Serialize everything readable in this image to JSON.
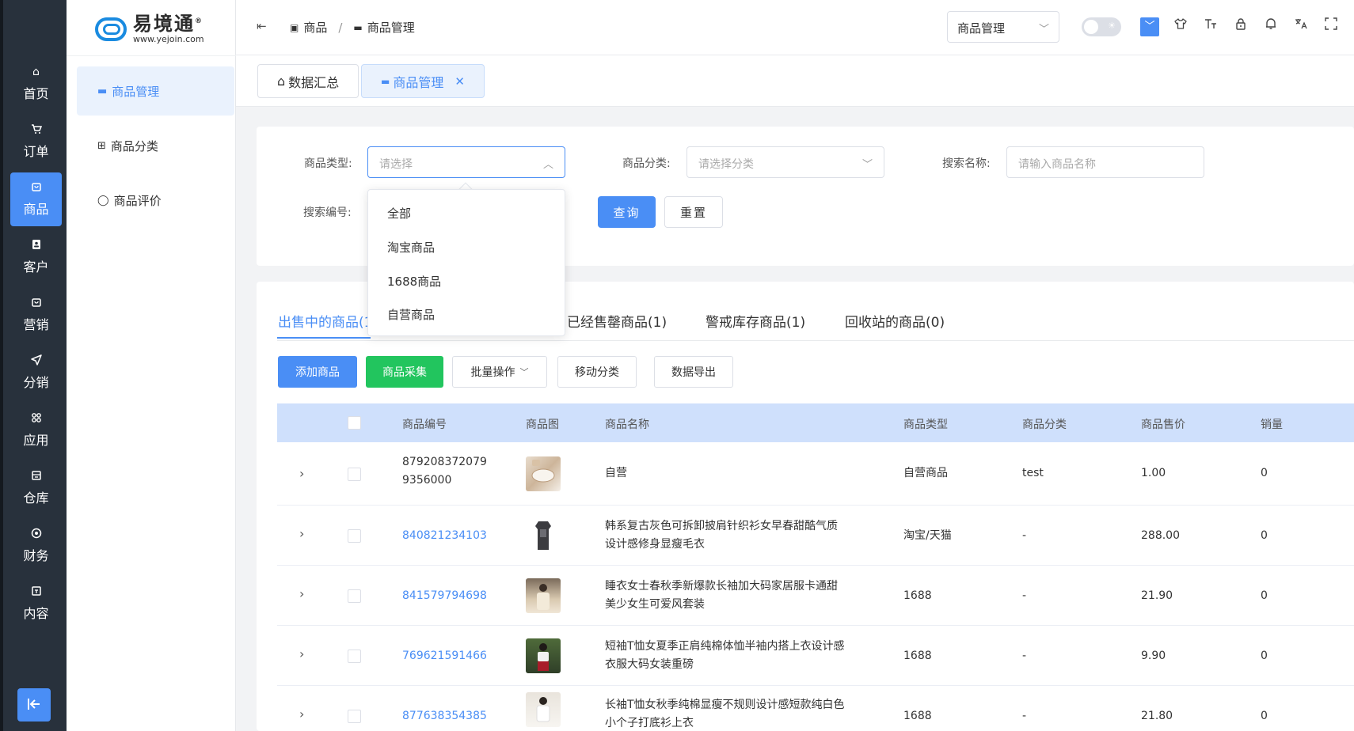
{
  "rail": {
    "items": [
      {
        "icon": "⌂",
        "label": "首页"
      },
      {
        "icon": "🛒",
        "label": "订单"
      },
      {
        "icon": "▣",
        "label": "商品"
      },
      {
        "icon": "▤",
        "label": "客户"
      },
      {
        "icon": "▣",
        "label": "营销"
      },
      {
        "icon": "➤",
        "label": "分销"
      },
      {
        "icon": "⁘",
        "label": "应用"
      },
      {
        "icon": "▭",
        "label": "仓库"
      },
      {
        "icon": "◉",
        "label": "财务"
      },
      {
        "icon": "▢",
        "label": "内容"
      }
    ],
    "active_index": 2
  },
  "logo": {
    "title": "易境通",
    "url": "www.yejoin.com",
    "mark": "®"
  },
  "submenu": {
    "items": [
      {
        "icon": "▬",
        "label": "商品管理"
      },
      {
        "icon": "⊞",
        "label": "商品分类"
      },
      {
        "icon": "◯",
        "label": "商品评价"
      }
    ]
  },
  "header": {
    "back_icon": "⇤",
    "breadcrumb": [
      {
        "icon": "▣",
        "label": "商品"
      },
      {
        "icon": "▬",
        "label": "商品管理"
      }
    ],
    "breadcrumb_sep": "/",
    "select_value": "商品管理",
    "icons": [
      "shirt-icon",
      "font-size-icon",
      "lock-icon",
      "bell-icon",
      "translate-icon",
      "fullscreen-icon"
    ]
  },
  "tabs": [
    {
      "icon": "⌂",
      "label": "数据汇总"
    },
    {
      "icon": "▬",
      "label": "商品管理",
      "closable": true
    }
  ],
  "filter": {
    "type_label": "商品类型:",
    "type_placeholder": "请选择",
    "category_label": "商品分类:",
    "category_placeholder": "请选择分类",
    "name_label": "搜索名称:",
    "name_placeholder": "请输入商品名称",
    "code_label": "搜索编号:",
    "query_button": "查询",
    "reset_button": "重置"
  },
  "dropdown": {
    "options": [
      "全部",
      "淘宝商品",
      "1688商品",
      "自营商品"
    ]
  },
  "list_tabs": [
    {
      "label": "出售中的商品(1"
    },
    {
      "label": "已经售罄商品(1)"
    },
    {
      "label": "警戒库存商品(1)"
    },
    {
      "label": "回收站的商品(0)"
    }
  ],
  "actions": {
    "add": "添加商品",
    "collect": "商品采集",
    "batch": "批量操作",
    "move": "移动分类",
    "export": "数据导出"
  },
  "table": {
    "columns": [
      "商品编号",
      "商品图",
      "商品名称",
      "商品类型",
      "商品分类",
      "商品售价",
      "销量"
    ],
    "rows": [
      {
        "code_line1": "879208372079",
        "code_line2": "9356000",
        "name_line1": "自营",
        "name_line2": "",
        "type": "自营商品",
        "category": "test",
        "price": "1.00",
        "sales": "0"
      },
      {
        "code_line1": "840821234103",
        "code_line2": "",
        "name_line1": "韩系复古灰色可拆卸披肩针织衫女早春甜酷气质",
        "name_line2": "设计感修身显瘦毛衣",
        "type": "淘宝/天猫",
        "category": "-",
        "price": "288.00",
        "sales": "0"
      },
      {
        "code_line1": "841579794698",
        "code_line2": "",
        "name_line1": "睡衣女士春秋季新爆款长袖加大码家居服卡通甜",
        "name_line2": "美少女生可爱风套装",
        "type": "1688",
        "category": "-",
        "price": "21.90",
        "sales": "0"
      },
      {
        "code_line1": "769621591466",
        "code_line2": "",
        "name_line1": "短袖T恤女夏季正肩纯棉体恤半袖内搭上衣设计感",
        "name_line2": "衣服大码女装重磅",
        "type": "1688",
        "category": "-",
        "price": "9.90",
        "sales": "0"
      },
      {
        "code_line1": "877638354385",
        "code_line2": "",
        "name_line1": "长袖T恤女秋季纯棉显瘦不规则设计感短款纯白色",
        "name_line2": "小个子打底衫上衣",
        "type": "1688",
        "category": "-",
        "price": "21.80",
        "sales": "0"
      }
    ]
  },
  "colors": {
    "accent": "#4a8ef5",
    "green": "#22c55e",
    "rail_bg": "#28313c",
    "table_head": "#cfe0fc"
  }
}
